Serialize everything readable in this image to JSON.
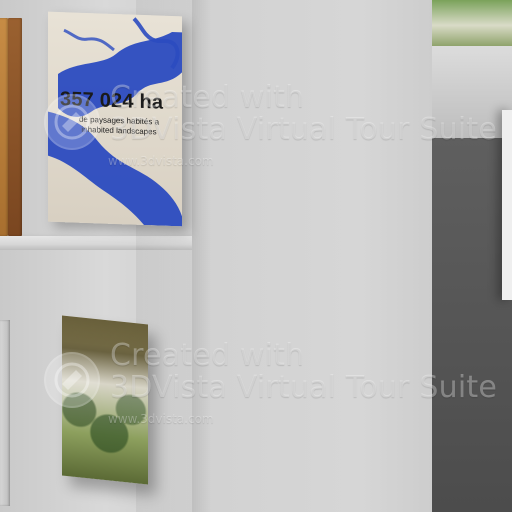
{
  "watermark": {
    "line1": "Created with",
    "line2": "3DVista Virtual Tour Suite",
    "url": "www.3dvista.com",
    "text_color": "#FFFFFF"
  },
  "books": {
    "map_book": {
      "title": "357 024 ha",
      "subtitle": "de paysages habités a\ninhabited landscapes",
      "map_color": "#2B4BC0"
    }
  },
  "icons": {
    "watermark_logo": "3dvista-logo-icon"
  }
}
